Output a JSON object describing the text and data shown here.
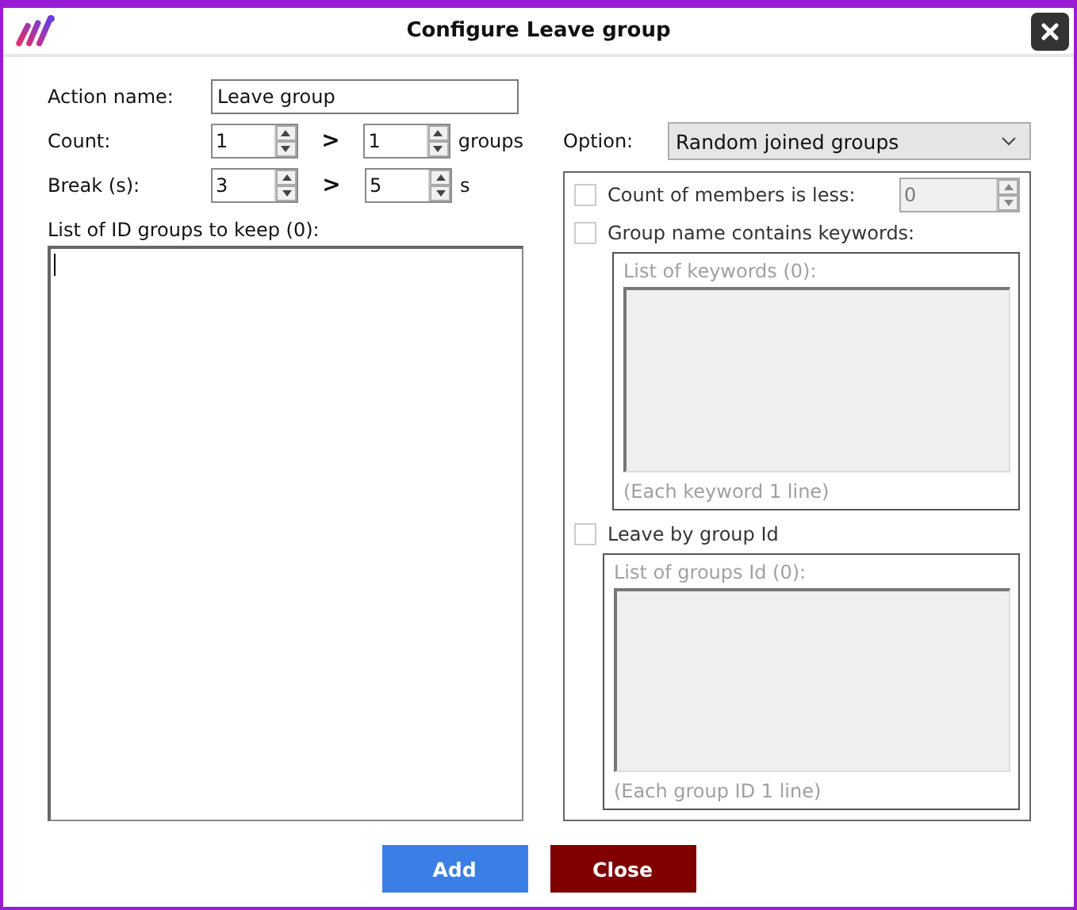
{
  "window": {
    "title": "Configure Leave group"
  },
  "action_name": {
    "label": "Action name:",
    "value": "Leave group"
  },
  "count": {
    "label": "Count:",
    "from": "1",
    "separator": ">",
    "to": "1",
    "unit": "groups"
  },
  "break": {
    "label": "Break (s):",
    "from": "3",
    "separator": ">",
    "to": "5",
    "unit": "s"
  },
  "keep_list": {
    "label": "List of ID groups to keep (0):"
  },
  "option": {
    "label": "Option:",
    "value": "Random joined groups"
  },
  "filters": [
    {
      "kind": "number",
      "label": "Count of members is less:",
      "checked": false,
      "value": "0"
    },
    {
      "kind": "list",
      "label": "Group name contains keywords:",
      "checked": false,
      "list_label": "List of keywords (0):",
      "hint": "(Each keyword 1 line)"
    },
    {
      "kind": "list",
      "label": "Leave by group Id",
      "checked": false,
      "list_label": "List of groups Id (0):",
      "hint": "(Each group ID 1 line)"
    }
  ],
  "buttons": [
    {
      "label": "Add",
      "kind": "primary"
    },
    {
      "label": "Close",
      "kind": "danger"
    }
  ]
}
